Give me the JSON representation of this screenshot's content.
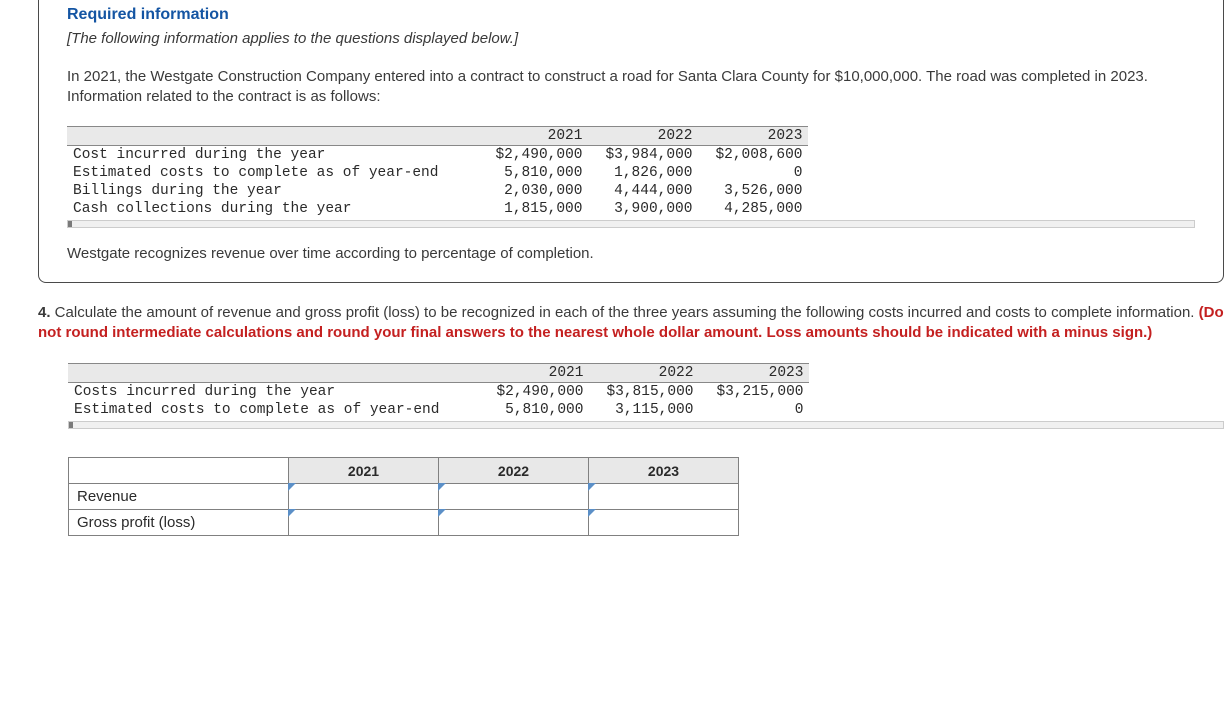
{
  "panel": {
    "required_title": "Required information",
    "italic_note": "[The following information applies to the questions displayed below.]",
    "intro": "In 2021, the Westgate Construction Company entered into a contract to construct a road for Santa Clara County for $10,000,000. The road was completed in 2023. Information related to the contract is as follows:",
    "table1": {
      "headers": [
        "",
        "2021",
        "2022",
        "2023"
      ],
      "rows": [
        {
          "label": "Cost incurred during the year",
          "c1": "$2,490,000",
          "c2": "$3,984,000",
          "c3": "$2,008,600"
        },
        {
          "label": "Estimated costs to complete as of year-end",
          "c1": "5,810,000",
          "c2": "1,826,000",
          "c3": "0"
        },
        {
          "label": "Billings during the year",
          "c1": "2,030,000",
          "c2": "4,444,000",
          "c3": "3,526,000"
        },
        {
          "label": "Cash collections during the year",
          "c1": "1,815,000",
          "c2": "3,900,000",
          "c3": "4,285,000"
        }
      ]
    },
    "closing": "Westgate recognizes revenue over time according to percentage of completion."
  },
  "question": {
    "num": "4.",
    "text_plain": " Calculate the amount of revenue and gross profit (loss) to be recognized in each of the three years assuming the following costs incurred and costs to complete information. ",
    "text_red": "(Do not round intermediate calculations and round your final answers to the nearest whole dollar amount. Loss amounts should be indicated with a minus sign.)",
    "table2": {
      "headers": [
        "",
        "2021",
        "2022",
        "2023"
      ],
      "rows": [
        {
          "label": "Costs incurred during the year",
          "c1": "$2,490,000",
          "c2": "$3,815,000",
          "c3": "$3,215,000"
        },
        {
          "label": "Estimated costs to complete as of year-end",
          "c1": "5,810,000",
          "c2": "3,115,000",
          "c3": "0"
        }
      ]
    }
  },
  "answer": {
    "col_headers": [
      "2021",
      "2022",
      "2023"
    ],
    "row_labels": [
      "Revenue",
      "Gross profit (loss)"
    ]
  }
}
